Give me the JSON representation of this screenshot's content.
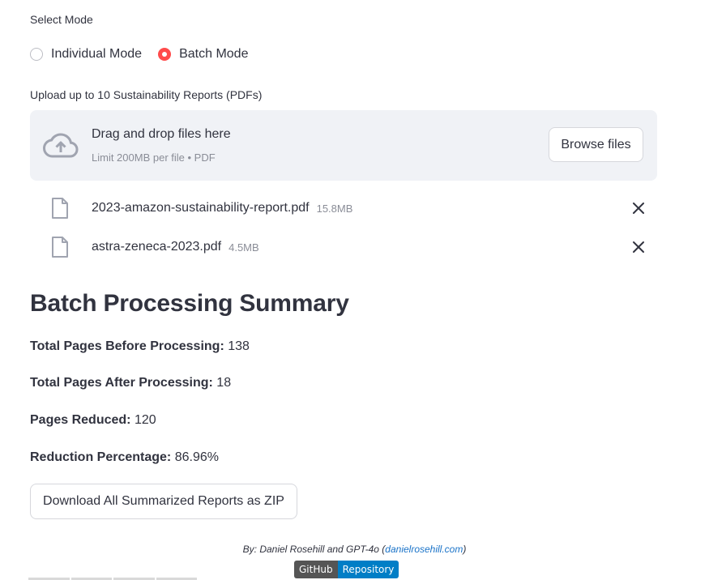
{
  "mode": {
    "label": "Select Mode",
    "options": [
      {
        "label": "Individual Mode",
        "selected": false
      },
      {
        "label": "Batch Mode",
        "selected": true
      }
    ]
  },
  "uploader": {
    "label": "Upload up to 10 Sustainability Reports (PDFs)",
    "title": "Drag and drop files here",
    "limit": "Limit 200MB per file • PDF",
    "browse_label": "Browse files",
    "icon": "cloud-upload-icon"
  },
  "files": [
    {
      "name": "2023-amazon-sustainability-report.pdf",
      "size": "15.8MB"
    },
    {
      "name": "astra-zeneca-2023.pdf",
      "size": "4.5MB"
    }
  ],
  "summary": {
    "heading": "Batch Processing Summary",
    "stats": [
      {
        "label": "Total Pages Before Processing:",
        "value": "138"
      },
      {
        "label": "Total Pages After Processing:",
        "value": "18"
      },
      {
        "label": "Pages Reduced:",
        "value": "120"
      },
      {
        "label": "Reduction Percentage:",
        "value": "86.96%"
      }
    ],
    "download_label": "Download All Summarized Reports as ZIP"
  },
  "footer": {
    "byline": "By: Daniel Rosehill and GPT-4o (",
    "link": "danielrosehill.com",
    "close": ")",
    "badge_left": "GitHub",
    "badge_right": "Repository"
  },
  "colors": {
    "accent": "#ff4b4b",
    "dropzone_bg": "#f0f2f6",
    "link": "#1a73c8",
    "badge_left_bg": "#555555",
    "badge_right_bg": "#007ec6"
  }
}
